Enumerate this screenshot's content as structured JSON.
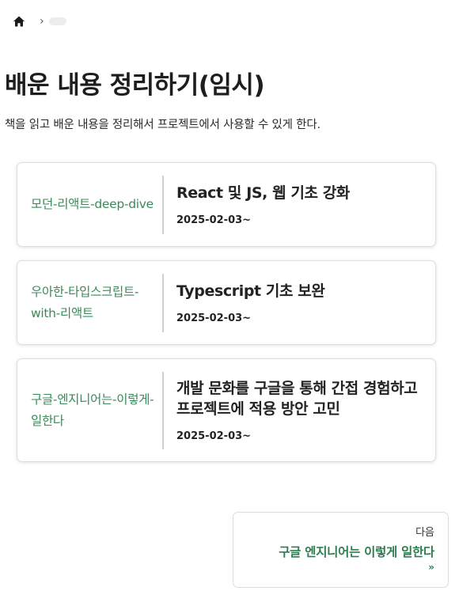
{
  "breadcrumb": {
    "home_icon": "home-icon",
    "separator": "›"
  },
  "page": {
    "title": "배운 내용 정리하기(임시)",
    "description": "책을 읽고 배운 내용을 정리해서 프로젝트에서 사용할 수 있게 한다."
  },
  "cards": [
    {
      "tag": "모던-리액트-deep-dive",
      "title": "React 및 JS, 웹 기초 강화",
      "date": "2025-02-03~"
    },
    {
      "tag": "우아한-타입스크립트-with-리액트",
      "title": "Typescript 기초 보완",
      "date": "2025-02-03~"
    },
    {
      "tag": "구글-엔지니어는-이렇게-일한다",
      "title": "개발 문화를 구글을 통해 간접 경험하고 프로젝트에 적용 방안 고민",
      "date": "2025-02-03~"
    }
  ],
  "next": {
    "label": "다음",
    "title": "구글 엔지니어는 이렇게 일한다",
    "arrow": "»"
  },
  "colors": {
    "tag_green": "#3a8a58",
    "next_green": "#2e7d4f"
  }
}
